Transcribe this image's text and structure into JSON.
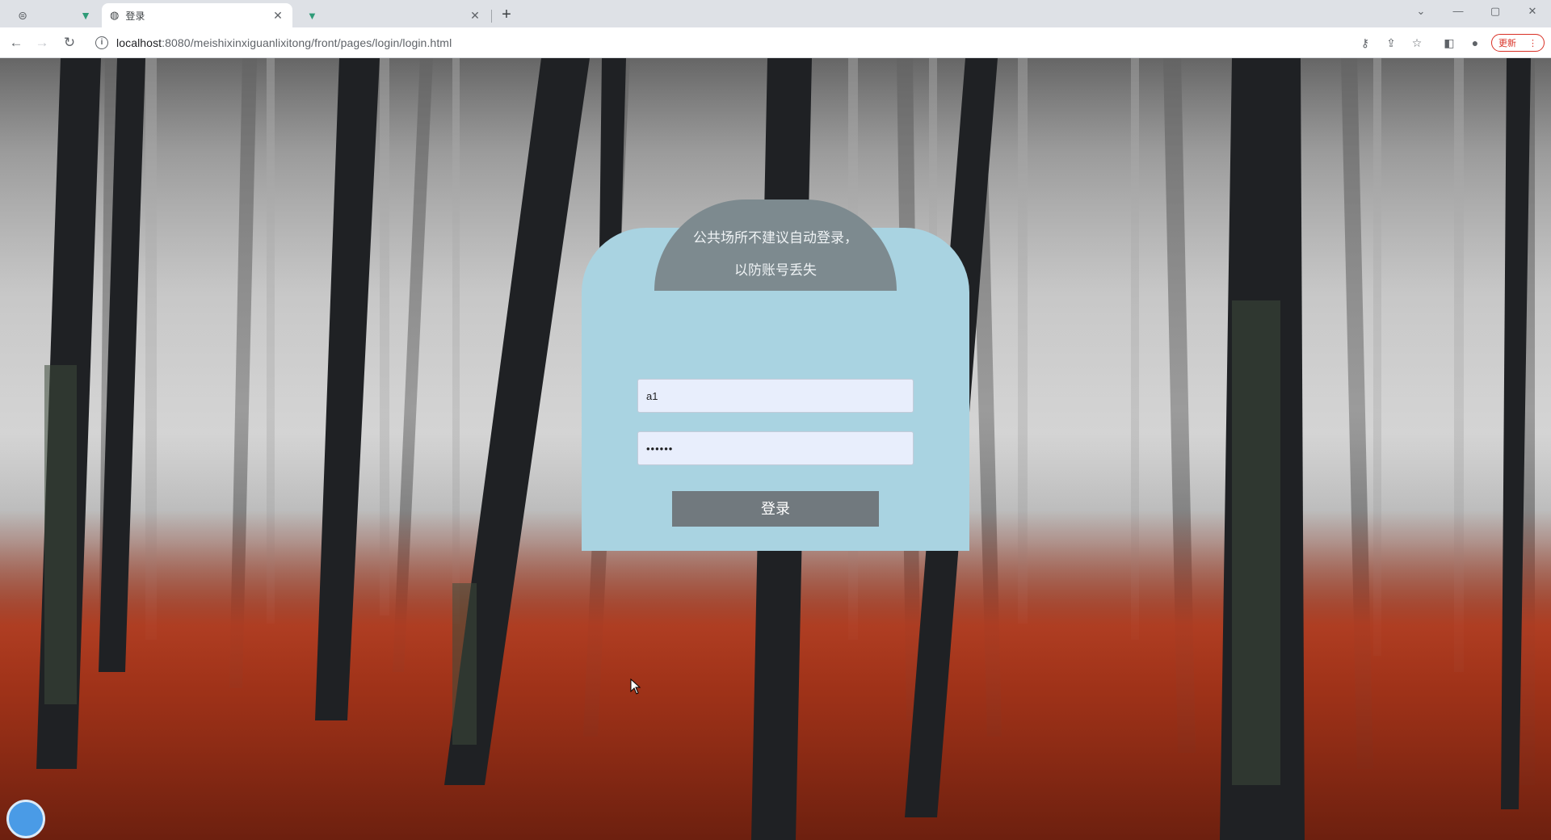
{
  "browser": {
    "tabs": [
      {
        "title": "",
        "icon": "globe-icon"
      },
      {
        "title": "",
        "icon": "blank-icon"
      },
      {
        "title": "",
        "icon": "vue-icon"
      },
      {
        "title": "登录",
        "icon": "globe-icon",
        "active": true
      },
      {
        "title": "",
        "icon": "vue-icon"
      }
    ],
    "new_tab_label": "+",
    "url_host": "localhost",
    "url_path": ":8080/meishixinxiguanlixitong/front/pages/login/login.html",
    "update_label": "更新",
    "window_controls": [
      "—",
      "▢",
      "✕"
    ]
  },
  "login": {
    "notice": "公共场所不建议自动登录，以防账号丢失",
    "username_value": "a1",
    "password_value": "••••••",
    "login_button": "登录",
    "register_link": ""
  },
  "floating_badge": ""
}
